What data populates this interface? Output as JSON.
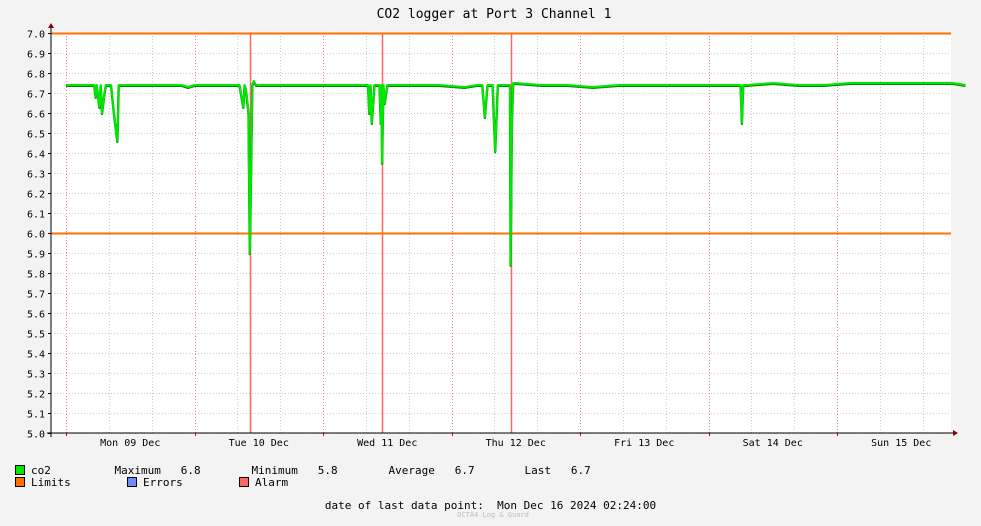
{
  "chart_data": {
    "type": "line",
    "title": "CO2 logger at Port 3 Channel 1",
    "ylim": [
      5.0,
      7.0
    ],
    "yticks": [
      "5.0",
      "5.1",
      "5.2",
      "5.3",
      "5.4",
      "5.5",
      "5.6",
      "5.7",
      "5.8",
      "5.9",
      "6.0",
      "6.1",
      "6.2",
      "6.3",
      "6.4",
      "6.5",
      "6.6",
      "6.7",
      "6.8",
      "6.9",
      "7.0"
    ],
    "xlim": [
      0,
      7
    ],
    "xtick_labels": [
      "Mon 09 Dec",
      "Tue 10 Dec",
      "Wed 11 Dec",
      "Thu 12 Dec",
      "Fri 13 Dec",
      "Sat 14 Dec",
      "Sun 15 Dec"
    ],
    "limits": [
      6.0,
      7.0
    ],
    "alarms": [
      1.43,
      2.46,
      3.46
    ],
    "series": [
      {
        "name": "co2",
        "color": "#00e800",
        "x": [
          0.0,
          0.18,
          0.22,
          0.23,
          0.24,
          0.26,
          0.27,
          0.28,
          0.3,
          0.31,
          0.32,
          0.35,
          0.38,
          0.4,
          0.41,
          0.42,
          0.44,
          0.6,
          0.9,
          0.95,
          1.0,
          1.2,
          1.35,
          1.38,
          1.39,
          1.4,
          1.42,
          1.43,
          1.44,
          1.45,
          1.46,
          1.48,
          1.6,
          1.8,
          2.0,
          2.2,
          2.3,
          2.35,
          2.36,
          2.37,
          2.38,
          2.4,
          2.42,
          2.44,
          2.45,
          2.455,
          2.46,
          2.47,
          2.48,
          2.5,
          2.7,
          2.9,
          3.1,
          3.2,
          3.22,
          3.24,
          3.26,
          3.28,
          3.3,
          3.32,
          3.34,
          3.36,
          3.38,
          3.4,
          3.44,
          3.45,
          3.455,
          3.46,
          3.47,
          3.48,
          3.5,
          3.7,
          3.9,
          4.1,
          4.3,
          4.5,
          4.7,
          4.9,
          5.1,
          5.2,
          5.25,
          5.26,
          5.27,
          5.28,
          5.3,
          5.5,
          5.7,
          5.9,
          6.1,
          6.3,
          6.5,
          6.7,
          6.9,
          7.0
        ],
        "values": [
          6.74,
          6.74,
          6.74,
          6.68,
          6.74,
          6.63,
          6.74,
          6.6,
          6.7,
          6.74,
          6.74,
          6.74,
          6.56,
          6.46,
          6.74,
          6.74,
          6.74,
          6.74,
          6.74,
          6.73,
          6.74,
          6.74,
          6.74,
          6.63,
          6.74,
          6.72,
          6.6,
          5.9,
          6.28,
          6.74,
          6.76,
          6.74,
          6.74,
          6.74,
          6.74,
          6.74,
          6.74,
          6.74,
          6.6,
          6.74,
          6.55,
          6.74,
          6.74,
          6.74,
          6.55,
          6.74,
          6.35,
          6.74,
          6.65,
          6.74,
          6.74,
          6.74,
          6.73,
          6.74,
          6.74,
          6.74,
          6.58,
          6.74,
          6.74,
          6.74,
          6.41,
          6.74,
          6.74,
          6.74,
          6.74,
          6.74,
          6.74,
          5.84,
          6.55,
          6.75,
          6.75,
          6.74,
          6.74,
          6.73,
          6.74,
          6.74,
          6.74,
          6.74,
          6.74,
          6.74,
          6.74,
          6.55,
          6.74,
          6.74,
          6.74,
          6.75,
          6.74,
          6.74,
          6.75,
          6.75,
          6.75,
          6.75,
          6.75,
          6.74
        ]
      }
    ]
  },
  "stats": {
    "name": "co2",
    "maximum_label": "Maximum",
    "maximum": "6.8",
    "minimum_label": "Minimum",
    "minimum": "5.8",
    "average_label": "Average",
    "average": "6.7",
    "last_label": "Last",
    "last": "6.7"
  },
  "legend": {
    "limits_label": "Limits",
    "errors_label": "Errors",
    "alarm_label": "Alarm"
  },
  "colors": {
    "series": "#00e800",
    "series_shadow": "#008a00",
    "limits": "#ff7000",
    "errors": "#6f8cff",
    "alarm": "#ff6666"
  },
  "footer": {
    "last_point_label": "date of last data point:",
    "last_point_value": "Mon Dec 16 2024 02:24:00",
    "watermark": "OCTA4 Log & Guard"
  }
}
